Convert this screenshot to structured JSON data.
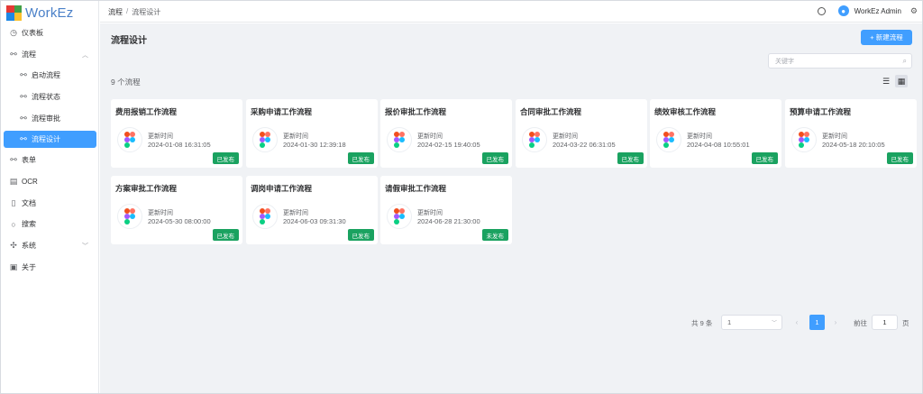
{
  "app": {
    "name": "WorkEz"
  },
  "sidebar": {
    "items": [
      {
        "label": "仪表板",
        "icon": "dashboard-icon"
      },
      {
        "label": "流程",
        "icon": "flow-icon"
      },
      {
        "label": "启动流程",
        "icon": "flow-icon"
      },
      {
        "label": "流程状态",
        "icon": "flow-icon"
      },
      {
        "label": "流程审批",
        "icon": "flow-icon"
      },
      {
        "label": "流程设计",
        "icon": "flow-icon"
      },
      {
        "label": "表单",
        "icon": "form-icon"
      },
      {
        "label": "OCR",
        "icon": "ocr-icon"
      },
      {
        "label": "文档",
        "icon": "document-icon"
      },
      {
        "label": "搜索",
        "icon": "search-icon"
      },
      {
        "label": "系统",
        "icon": "system-icon"
      },
      {
        "label": "关于",
        "icon": "about-icon"
      }
    ]
  },
  "header": {
    "breadcrumb": [
      "流程",
      "/",
      "流程设计"
    ],
    "user": "WorkEz Admin"
  },
  "main": {
    "title": "流程设计",
    "new_button": "+ 新建流程",
    "search_placeholder": "关键字",
    "count_label": "9 个流程",
    "time_label": "更新时间",
    "cards": [
      {
        "title": "费用报销工作流程",
        "time": "2024-01-08 16:31:05",
        "status": "已发布"
      },
      {
        "title": "采购申请工作流程",
        "time": "2024-01-30 12:39:18",
        "status": "已发布"
      },
      {
        "title": "报价审批工作流程",
        "time": "2024-02-15 19:40:05",
        "status": "已发布"
      },
      {
        "title": "合同审批工作流程",
        "time": "2024-03-22 06:31:05",
        "status": "已发布"
      },
      {
        "title": "绩效审核工作流程",
        "time": "2024-04-08 10:55:01",
        "status": "已发布"
      },
      {
        "title": "预算申请工作流程",
        "time": "2024-05-18 20:10:05",
        "status": "已发布"
      },
      {
        "title": "方案审批工作流程",
        "time": "2024-05-30 08:00:00",
        "status": "已发布"
      },
      {
        "title": "调岗申请工作流程",
        "time": "2024-06-03 09:31:30",
        "status": "已发布"
      },
      {
        "title": "请假审批工作流程",
        "time": "2024-06-28 21:30:00",
        "status": "未发布"
      }
    ]
  },
  "pagination": {
    "total": "共 9 条",
    "page_size": "1",
    "current": "1",
    "goto_label": "前往",
    "goto_value": "1",
    "page_suffix": "页"
  },
  "colors": {
    "primary": "#409eff",
    "published": "#1aa260",
    "background": "#f0f2f5"
  }
}
